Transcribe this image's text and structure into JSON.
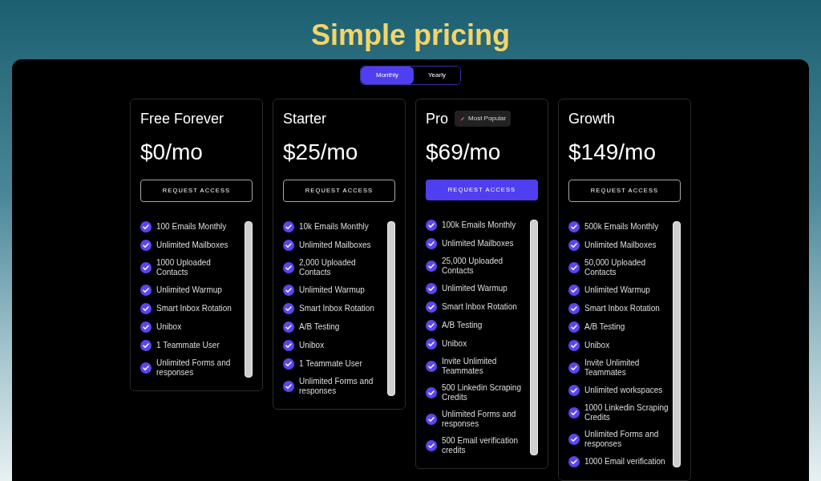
{
  "title": "Simple pricing",
  "billing_toggle": [
    {
      "label": "Monthly",
      "selected": true
    },
    {
      "label": "Yearly",
      "selected": false
    }
  ],
  "plans": [
    {
      "name": "Free Forever",
      "price": "$0/mo",
      "button": "REQUEST ACCESS",
      "highlighted": false,
      "features": [
        "100 Emails Monthly",
        "Unlimited Mailboxes",
        "1000 Uploaded Contacts",
        "Unlimited Warmup",
        "Smart Inbox Rotation",
        "Unibox",
        "1 Teammate User",
        "Unlimited Forms and responses"
      ]
    },
    {
      "name": "Starter",
      "price": "$25/mo",
      "button": "REQUEST ACCESS",
      "highlighted": false,
      "features": [
        "10k Emails Monthly",
        "Unlimited Mailboxes",
        "2,000 Uploaded Contacts",
        "Unlimited Warmup",
        "Smart Inbox Rotation",
        "A/B Testing",
        "Unibox",
        "1 Teammate User",
        "Unlimited Forms and responses"
      ]
    },
    {
      "name": "Pro",
      "badge": "Most Popular",
      "price": "$69/mo",
      "button": "REQUEST ACCESS",
      "highlighted": true,
      "features": [
        "100k Emails Monthly",
        "Unlimited Mailboxes",
        "25,000 Uploaded Contacts",
        "Unlimited Warmup",
        "Smart Inbox Rotation",
        "A/B Testing",
        "Unibox",
        "Invite Unlimited Teammates",
        "500 Linkedin Scraping Credits",
        "Unlimited Forms and responses",
        "500 Email verification credits"
      ]
    },
    {
      "name": "Growth",
      "price": "$149/mo",
      "button": "REQUEST ACCESS",
      "highlighted": false,
      "features": [
        "500k Emails Monthly",
        "Unlimited Mailboxes",
        "50,000 Uploaded Contacts",
        "Unlimited Warmup",
        "Smart Inbox Rotation",
        "A/B Testing",
        "Unibox",
        "Invite Unlimited Teammates",
        "Unlimited workspaces",
        "1000 Linkedin Scraping Credits",
        "Unlimited Forms and responses",
        "1000 Email verification"
      ]
    }
  ]
}
